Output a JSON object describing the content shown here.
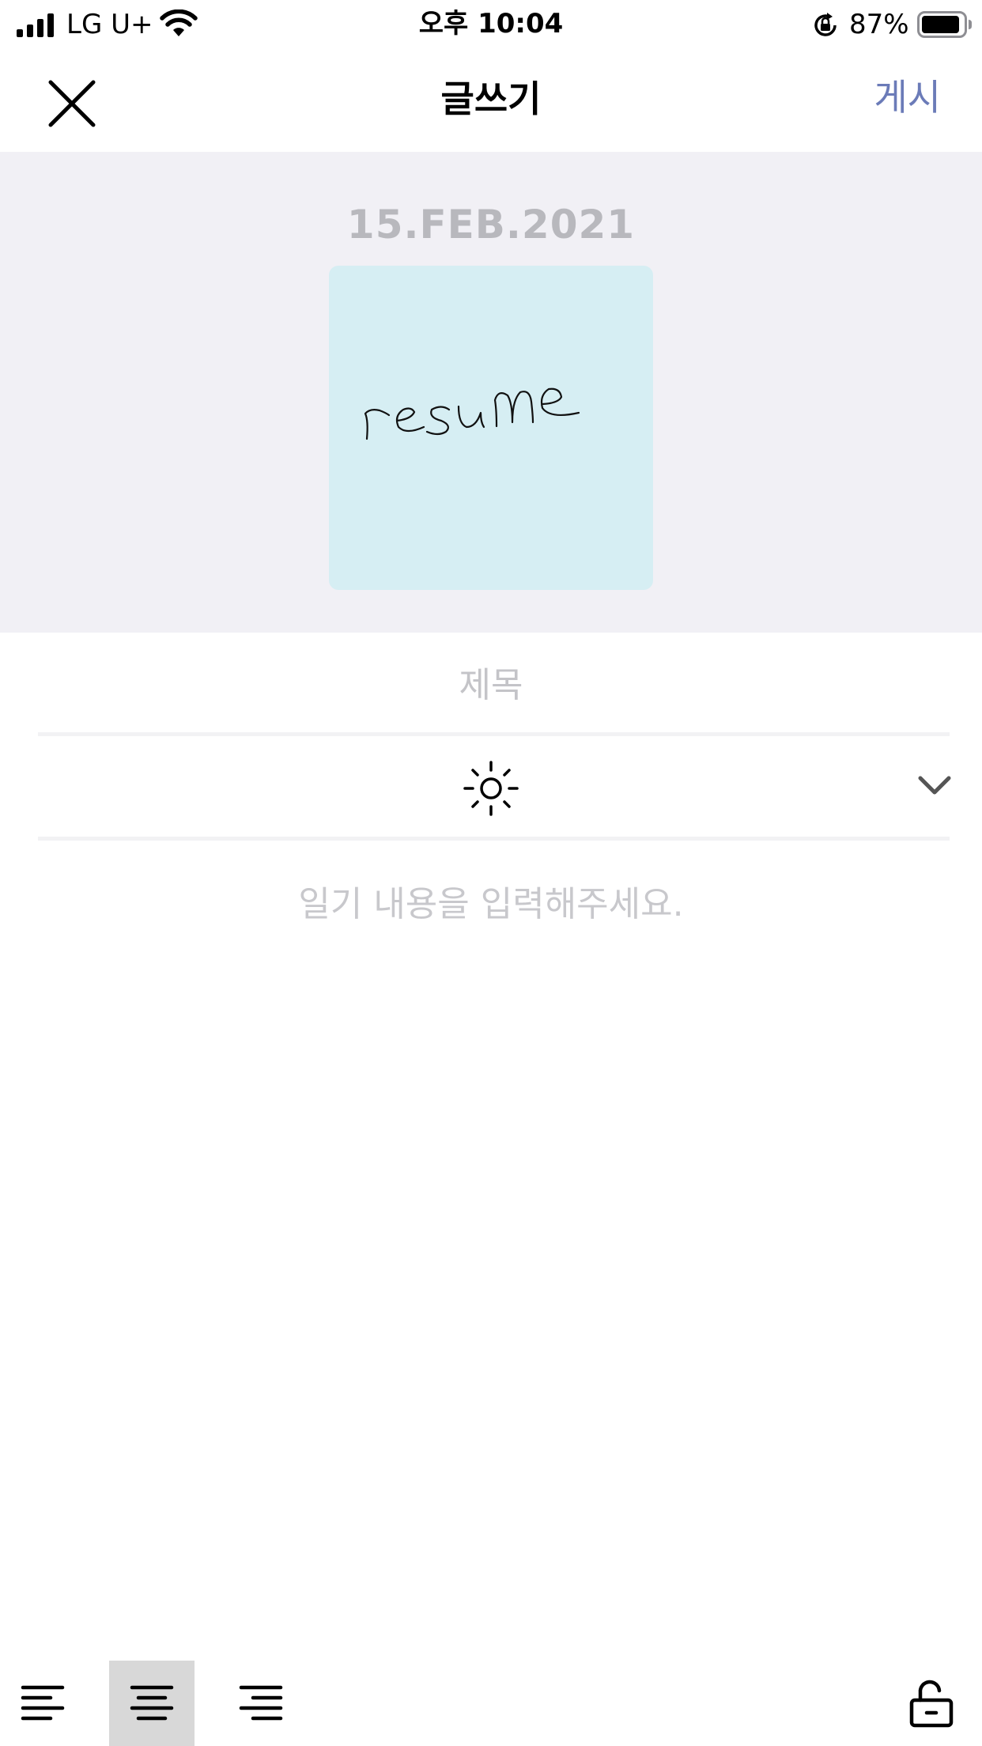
{
  "status_bar": {
    "carrier": "LG U+",
    "time": "오후 10:04",
    "battery_percent": "87%",
    "icons": [
      "signal-icon",
      "wifi-icon",
      "rotation-lock-icon",
      "battery-icon"
    ]
  },
  "nav": {
    "title": "글쓰기",
    "post_label": "게시",
    "post_color": "#6b7bb8",
    "close_icon": "close-icon"
  },
  "entry": {
    "date": "15.FEB.2021",
    "image_handwriting": "resume",
    "image_background": "#d6eef3"
  },
  "form": {
    "title_value": "",
    "title_placeholder": "제목",
    "weather_icon": "sun-icon",
    "weather_dropdown_icon": "chevron-down-icon",
    "body_value": "",
    "body_placeholder": "일기 내용을 입력해주세요."
  },
  "toolbar": {
    "align_selected": "center",
    "items": [
      "align-left-icon",
      "align-center-icon",
      "align-right-icon",
      "unlock-icon"
    ]
  },
  "colors": {
    "header_background": "#f1f0f5",
    "date_color": "#b8b8bd",
    "selected_tool_background": "#d8d8d8"
  }
}
